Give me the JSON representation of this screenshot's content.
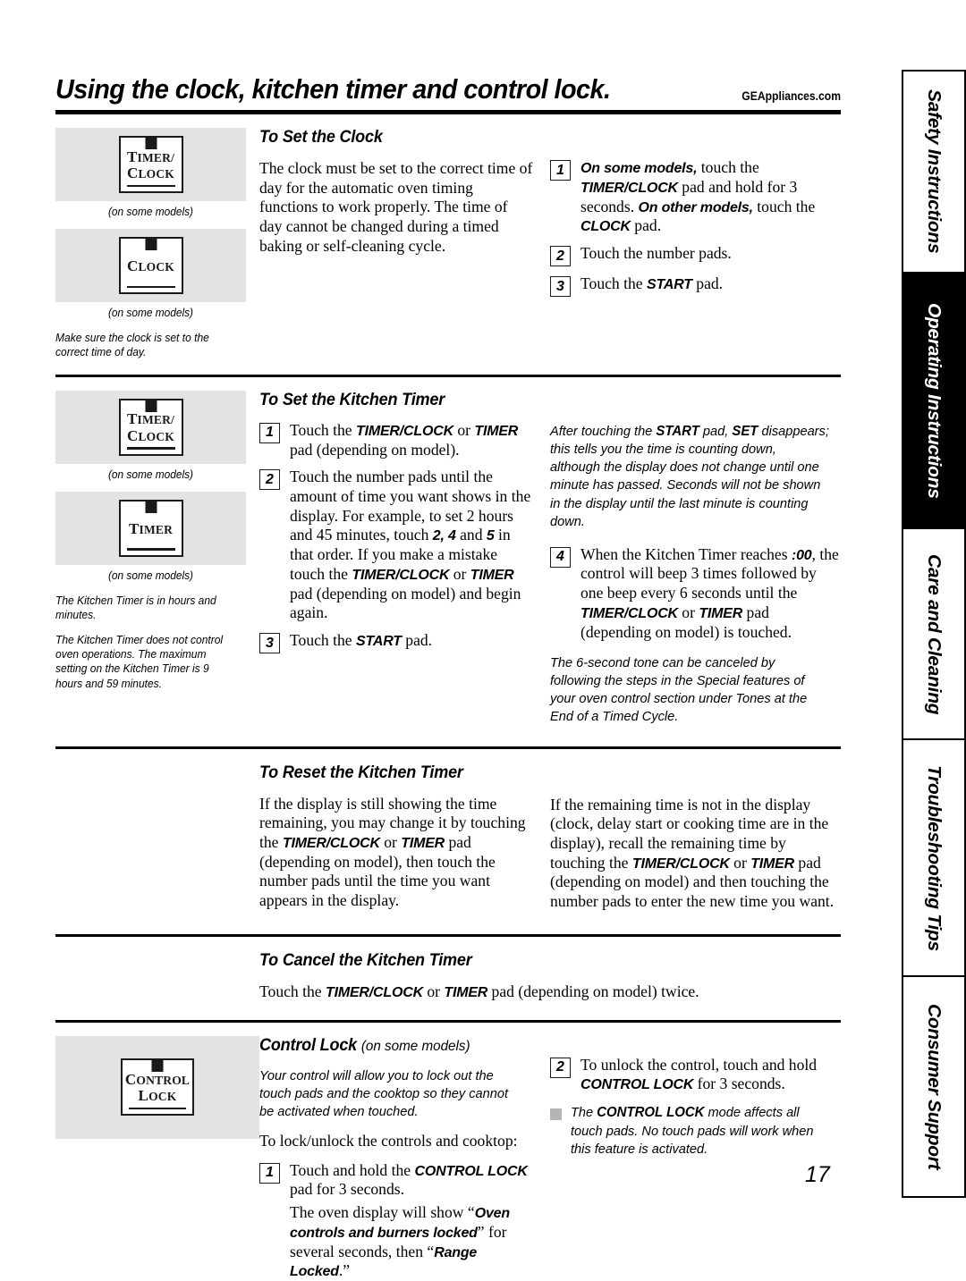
{
  "header": {
    "title": "Using the clock, kitchen timer and control lock.",
    "site": "GEAppliances.com"
  },
  "page_number": "17",
  "side_tabs": [
    {
      "label": "Safety Instructions",
      "active": false
    },
    {
      "label": "Operating Instructions",
      "active": true
    },
    {
      "label": "Care and Cleaning",
      "active": false
    },
    {
      "label": "Troubleshooting Tips",
      "active": false
    },
    {
      "label": "Consumer Support",
      "active": false
    }
  ],
  "sections": {
    "set_clock": {
      "heading": "To Set the Clock",
      "body": "The clock must be set to the correct time of day for the automatic oven timing functions to work properly. The time of day cannot be changed during a timed baking or self-cleaning cycle.",
      "illustrations": [
        {
          "pad_line1": "Timer/",
          "pad_line2": "Clock",
          "caption": "(on some models)"
        },
        {
          "pad_line1": "Clock",
          "pad_line2": "",
          "caption": "(on some models)"
        }
      ],
      "illus_notes": [
        "Make sure the clock is set to the correct time of day."
      ],
      "steps": [
        {
          "num": "1",
          "text_parts": [
            "On some models,",
            " touch the ",
            "TIMER/CLOCK",
            " pad and hold for 3 seconds. ",
            "On other models,",
            " touch the ",
            "CLOCK",
            " pad."
          ]
        },
        {
          "num": "2",
          "text": "Touch the number pads."
        },
        {
          "num": "3",
          "text_parts": [
            "Touch the ",
            "START",
            " pad."
          ]
        }
      ]
    },
    "set_timer": {
      "heading": "To Set the Kitchen Timer",
      "illustrations": [
        {
          "pad_line1": "Timer/",
          "pad_line2": "Clock",
          "caption": "(on some models)"
        },
        {
          "pad_line1": "Timer",
          "pad_line2": "",
          "caption": "(on some models)"
        }
      ],
      "illus_notes": [
        "The Kitchen Timer is in hours and minutes.",
        "The Kitchen Timer does not control oven operations. The maximum setting on the Kitchen Timer is 9 hours and 59 minutes."
      ],
      "steps": [
        {
          "num": "1"
        },
        {
          "num": "2"
        },
        {
          "num": "3"
        },
        {
          "num": "4"
        }
      ],
      "note_after_start": "After touching the START pad, SET disappears; this tells you the time is counting down, although the display does not change until one minute has passed. Seconds will not be shown in the display until the last minute is counting down.",
      "note_tone": "The 6-second tone can be canceled by following the steps in the Special features of your oven control section under Tones at the End of a Timed Cycle."
    },
    "reset_timer": {
      "heading": "To Reset the Kitchen Timer",
      "left_body": "If the display is still showing the time remaining, you may change it by touching the TIMER/CLOCK or TIMER pad (depending on model), then touch the number pads until the time you want appears in the display.",
      "right_body": "If the remaining time is not in the display (clock, delay start or cooking time are in the display), recall the remaining time by touching the TIMER/CLOCK or TIMER pad (depending on model) and then touching the number pads to enter the new time you want."
    },
    "cancel_timer": {
      "heading": "To Cancel the Kitchen Timer",
      "body": "Touch the TIMER/CLOCK or TIMER pad (depending on model) twice."
    },
    "control_lock": {
      "heading": "Control Lock",
      "heading_suffix": "(on some models)",
      "illustration": {
        "pad_line1": "Control",
        "pad_line2": "Lock"
      },
      "intro_note": "Your control will allow you to lock out the touch pads and the cooktop so they cannot be activated when touched.",
      "lead_in": "To lock/unlock the controls and cooktop:",
      "steps": [
        {
          "num": "1"
        },
        {
          "num": "2"
        }
      ],
      "bullet_note": "The CONTROL LOCK mode affects all touch pads. No touch pads will work when this feature is activated."
    }
  },
  "strings": {
    "timer_clock": "TIMER/CLOCK",
    "timer": "TIMER",
    "clock": "CLOCK",
    "start": "START",
    "control_lock": "CONTROL LOCK",
    "set": "SET",
    "or": " or ",
    "on_some_models": "(on some models)",
    "zero_zero": ":00",
    "oven_locked": "Oven controls and burners locked",
    "range_locked": "Range Locked"
  }
}
